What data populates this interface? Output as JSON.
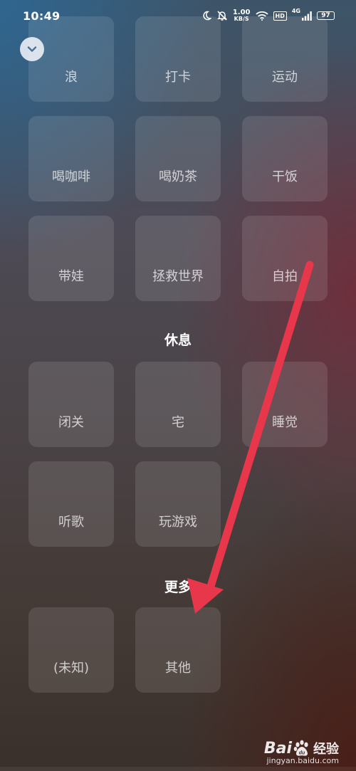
{
  "status_bar": {
    "time": "10:49",
    "net_speed_value": "1.00",
    "net_speed_unit": "KB/S",
    "hd_label": "HD",
    "signal_label": "4G",
    "battery": "97"
  },
  "groups": [
    {
      "title": "",
      "items": [
        "浪",
        "打卡",
        "运动",
        "喝咖啡",
        "喝奶茶",
        "干饭",
        "带娃",
        "拯救世界",
        "自拍"
      ]
    },
    {
      "title": "休息",
      "items": [
        "闭关",
        "宅",
        "睡觉",
        "听歌",
        "玩游戏"
      ]
    },
    {
      "title": "更多",
      "items": [
        "(未知)",
        "其他"
      ]
    }
  ],
  "annotation": {
    "arrow_color": "#e8364a"
  },
  "watermark": {
    "brand_left": "Bai",
    "brand_right": "经验",
    "url": "jingyan.baidu.com"
  }
}
